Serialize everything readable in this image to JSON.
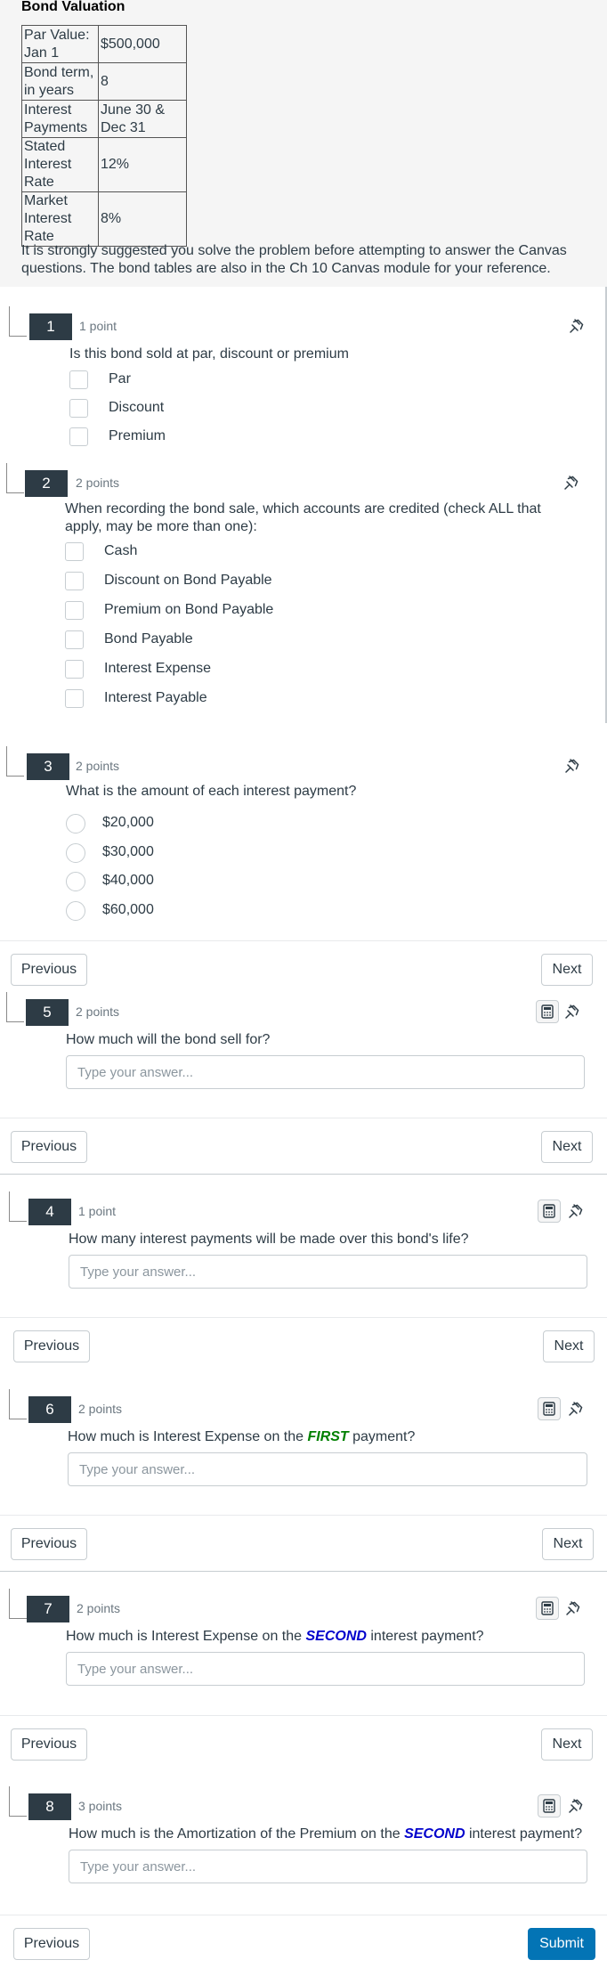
{
  "intro": {
    "title": "Bond Valuation",
    "table": [
      {
        "label": "Par Value: Jan 1",
        "value": "$500,000"
      },
      {
        "label": "Bond term, in years",
        "value": "8"
      },
      {
        "label": "Interest Payments",
        "value": "June 30 & Dec 31"
      },
      {
        "label": "Stated Interest Rate",
        "value": "12%"
      },
      {
        "label": "Market Interest Rate",
        "value": "8%"
      }
    ],
    "note": "It is strongly suggested you solve the problem before attempting to answer the Canvas questions.  The bond tables are also in the Ch 10 Canvas module for your reference."
  },
  "questions": [
    {
      "number": "1",
      "points": "1 point",
      "text": "Is this bond sold at par, discount or premium",
      "options": [
        "Par",
        "Discount",
        "Premium"
      ]
    },
    {
      "number": "2",
      "points": "2 points",
      "text": "When recording the bond sale, which accounts are credited (check ALL that apply, may be more than one):",
      "options": [
        "Cash",
        "Discount on Bond Payable",
        "Premium on Bond Payable",
        "Bond Payable",
        "Interest Expense",
        "Interest Payable"
      ]
    },
    {
      "number": "3",
      "points": "2 points",
      "text": "What is the amount of each interest payment?",
      "options": [
        "$20,000",
        "$30,000",
        "$40,000",
        "$60,000"
      ]
    },
    {
      "number": "5",
      "points": "2 points",
      "text": "How much will the bond sell for?"
    },
    {
      "number": "4",
      "points": "1 point",
      "text": "How many interest payments will be made over this bond's life?"
    },
    {
      "number": "6",
      "points": "2 points",
      "text_before": "How much is Interest Expense on the ",
      "emphasis": "FIRST",
      "text_after": " payment?"
    },
    {
      "number": "7",
      "points": "2 points",
      "text_before": "How much is Interest Expense on the ",
      "emphasis": "SECOND",
      "text_after": " interest payment?"
    },
    {
      "number": "8",
      "points": "3 points",
      "text_before": "How much is the Amortization of the Premium on the ",
      "emphasis": "SECOND",
      "text_after": " interest payment?"
    }
  ],
  "answer_placeholder": "Type your answer...",
  "buttons": {
    "previous": "Previous",
    "next": "Next",
    "submit": "Submit"
  },
  "icons": {
    "pin": "pin-icon",
    "calculator": "calculator-icon"
  },
  "colors": {
    "question_badge": "#2d3b45",
    "submit": "#0374b5",
    "first_emphasis": "#008000",
    "second_emphasis": "#0000cc"
  }
}
